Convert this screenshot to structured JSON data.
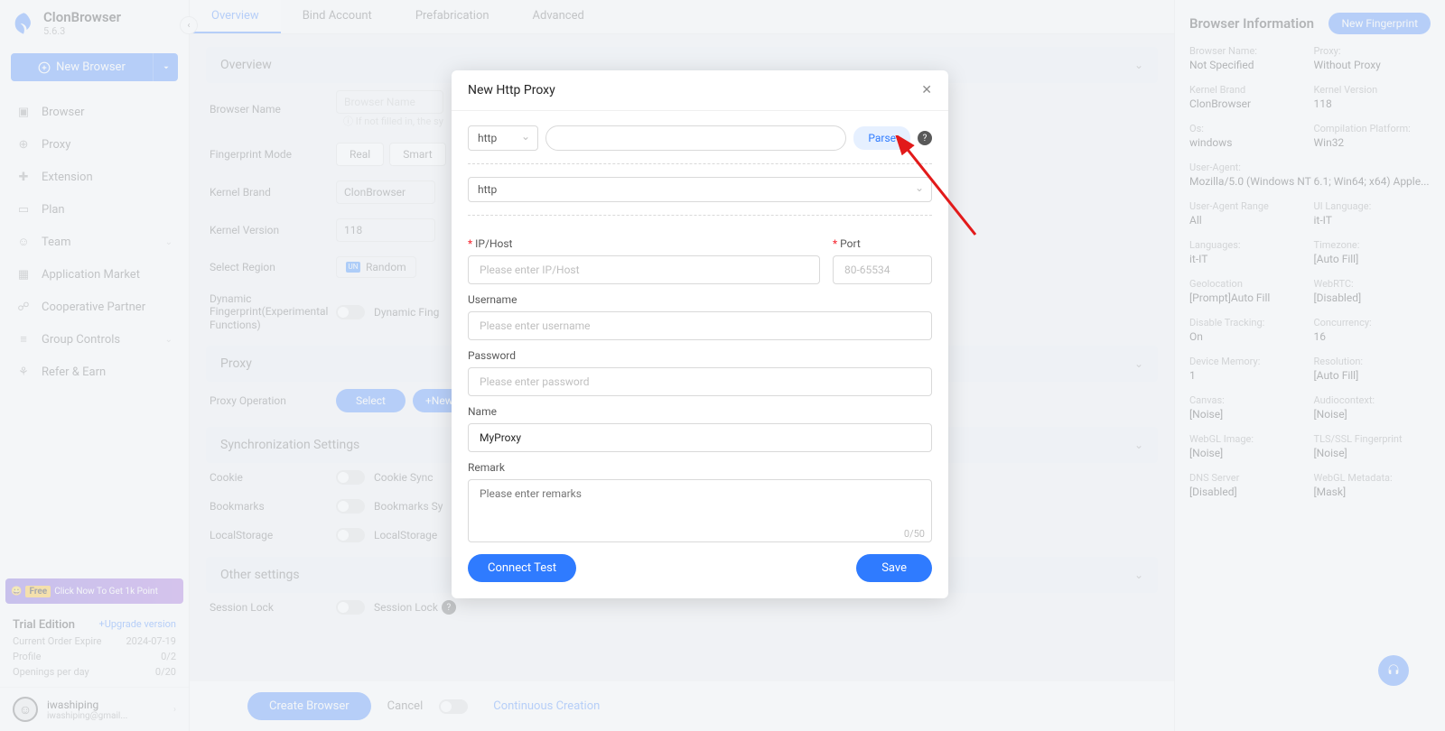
{
  "app": {
    "name": "ClonBrowser",
    "version": "5.6.3"
  },
  "sidebar": {
    "newBrowser": "New Browser",
    "items": [
      {
        "label": "Browser"
      },
      {
        "label": "Proxy"
      },
      {
        "label": "Extension"
      },
      {
        "label": "Plan"
      },
      {
        "label": "Team",
        "expandable": true
      },
      {
        "label": "Application Market"
      },
      {
        "label": "Cooperative Partner"
      },
      {
        "label": "Group Controls",
        "expandable": true
      },
      {
        "label": "Refer & Earn"
      }
    ],
    "promo": {
      "badge": "Free",
      "text": "Click Now To Get 1k Point"
    },
    "trial": {
      "title": "Trial Edition",
      "upgrade": "+Upgrade version",
      "rows": [
        {
          "k": "Current Order Expire",
          "v": "2024-07-19"
        },
        {
          "k": "Profile",
          "v": "0/2"
        },
        {
          "k": "Openings per day",
          "v": "0/20"
        }
      ]
    },
    "user": {
      "name": "iwashiping",
      "email": "iwashiping@gmail..."
    }
  },
  "tabs": [
    "Overview",
    "Bind Account",
    "Prefabrication",
    "Advanced"
  ],
  "overview": {
    "sectionTitle": "Overview",
    "browserNameLabel": "Browser Name",
    "browserNamePh": "Browser Name",
    "browserNameHint": "If not filled in, the sy",
    "fingerprintModeLabel": "Fingerprint Mode",
    "modes": [
      "Real",
      "Smart"
    ],
    "kernelBrandLabel": "Kernel Brand",
    "kernelBrandValue": "ClonBrowser",
    "kernelVersionLabel": "Kernel Version",
    "kernelVersionValue": "118",
    "selectRegionLabel": "Select Region",
    "regionValue": "Random",
    "dynFpLabel": "Dynamic Fingerprint(Experimental Functions)",
    "dynFpToggleText": "Dynamic Fing"
  },
  "proxySection": {
    "title": "Proxy",
    "opLabel": "Proxy Operation",
    "select": "Select",
    "newBtn": "+New"
  },
  "syncSection": {
    "title": "Synchronization Settings",
    "rows": [
      {
        "label": "Cookie",
        "text": "Cookie Sync"
      },
      {
        "label": "Bookmarks",
        "text": "Bookmarks Sy"
      },
      {
        "label": "LocalStorage",
        "text": "LocalStorage"
      }
    ]
  },
  "otherSection": {
    "title": "Other settings",
    "sessionLockLabel": "Session Lock",
    "sessionLockText": "Session Lock"
  },
  "bottom": {
    "create": "Create Browser",
    "cancel": "Cancel",
    "continuous": "Continuous Creation"
  },
  "rightPanel": {
    "title": "Browser Information",
    "newFp": "New Fingerprint",
    "items": [
      {
        "k": "Browser Name:",
        "v": "Not Specified"
      },
      {
        "k": "Proxy:",
        "v": "Without Proxy"
      },
      {
        "k": "Kernel Brand",
        "v": "ClonBrowser"
      },
      {
        "k": "Kernel Version",
        "v": "118"
      },
      {
        "k": "Os:",
        "v": "windows"
      },
      {
        "k": "Compilation Platform:",
        "v": "Win32"
      },
      {
        "k": "User-Agent:",
        "v": "Mozilla/5.0 (Windows NT 6.1; Win64; x64) Apple...",
        "full": true
      },
      {
        "k": "User-Agent Range",
        "v": "All"
      },
      {
        "k": "UI Language:",
        "v": "it-IT"
      },
      {
        "k": "Languages:",
        "v": "it-IT"
      },
      {
        "k": "Timezone:",
        "v": "[Auto Fill]"
      },
      {
        "k": "Geolocation",
        "v": "[Prompt]Auto Fill"
      },
      {
        "k": "WebRTC:",
        "v": "[Disabled]"
      },
      {
        "k": "Disable Tracking:",
        "v": "On"
      },
      {
        "k": "Concurrency:",
        "v": "16"
      },
      {
        "k": "Device Memory:",
        "v": "1"
      },
      {
        "k": "Resolution:",
        "v": "[Auto Fill]"
      },
      {
        "k": "Canvas:",
        "v": "[Noise]"
      },
      {
        "k": "Audiocontext:",
        "v": "[Noise]"
      },
      {
        "k": "WebGL Image:",
        "v": "[Noise]"
      },
      {
        "k": "TLS/SSL Fingerprint",
        "v": "[Noise]"
      },
      {
        "k": "DNS Server",
        "v": "[Disabled]"
      },
      {
        "k": "WebGL Metadata:",
        "v": "[Mask]"
      }
    ]
  },
  "modal": {
    "title": "New Http Proxy",
    "proto": "http",
    "parse": "Parse",
    "ipLabel": "IP/Host",
    "ipPh": "Please enter IP/Host",
    "portLabel": "Port",
    "portPh": "80-65534",
    "userLabel": "Username",
    "userPh": "Please enter username",
    "passLabel": "Password",
    "passPh": "Please enter password",
    "nameLabel": "Name",
    "nameValue": "MyProxy",
    "remarkLabel": "Remark",
    "remarkPh": "Please enter remarks",
    "charCount": "0/50",
    "connect": "Connect Test",
    "save": "Save"
  }
}
